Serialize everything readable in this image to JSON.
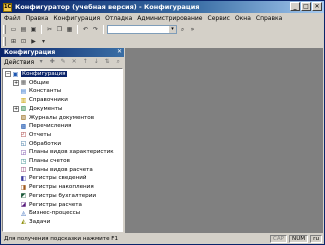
{
  "window": {
    "title": "Конфигуратор (учебная версия) - Конфигурация",
    "app_icon": "1C"
  },
  "menubar": {
    "items": [
      "Файл",
      "Правка",
      "Конфигурация",
      "Отладка",
      "Администрирование",
      "Сервис",
      "Окна",
      "Справка"
    ]
  },
  "toolbar1": {
    "icons": [
      "new-document-icon",
      "open-icon",
      "save-icon",
      "cut-icon",
      "copy-icon",
      "paste-icon",
      "undo-icon",
      "redo-icon",
      "find-icon"
    ]
  },
  "panel": {
    "title": "Конфигурация",
    "close_glyph": "✕",
    "actions_label": "Действия"
  },
  "tree": {
    "items": [
      {
        "label": "Конфигурация",
        "selected": true,
        "expander": "−",
        "icon": "config-icon"
      },
      {
        "label": "Общие",
        "expander": "+",
        "icon": "common-icon"
      },
      {
        "label": "Константы",
        "icon": "constants-icon"
      },
      {
        "label": "Справочники",
        "icon": "catalogs-icon"
      },
      {
        "label": "Документы",
        "expander": "+",
        "icon": "documents-icon"
      },
      {
        "label": "Журналы документов",
        "icon": "journals-icon"
      },
      {
        "label": "Перечисления",
        "icon": "enums-icon"
      },
      {
        "label": "Отчеты",
        "icon": "reports-icon"
      },
      {
        "label": "Обработки",
        "icon": "processing-icon"
      },
      {
        "label": "Планы видов характеристик",
        "icon": "chart-types-icon"
      },
      {
        "label": "Планы счетов",
        "icon": "chart-accounts-icon"
      },
      {
        "label": "Планы видов расчета",
        "icon": "calc-types-icon"
      },
      {
        "label": "Регистры сведений",
        "icon": "info-registers-icon"
      },
      {
        "label": "Регистры накопления",
        "icon": "accum-registers-icon"
      },
      {
        "label": "Регистры бухгалтерии",
        "icon": "accounting-registers-icon"
      },
      {
        "label": "Регистры расчета",
        "icon": "calc-registers-icon"
      },
      {
        "label": "Бизнес-процессы",
        "icon": "business-process-icon"
      },
      {
        "label": "Задачи",
        "icon": "tasks-icon"
      }
    ]
  },
  "statusbar": {
    "text": "Для получения подсказки нажмите F1",
    "indicators": [
      "CAP",
      "NUM",
      "ru"
    ]
  }
}
